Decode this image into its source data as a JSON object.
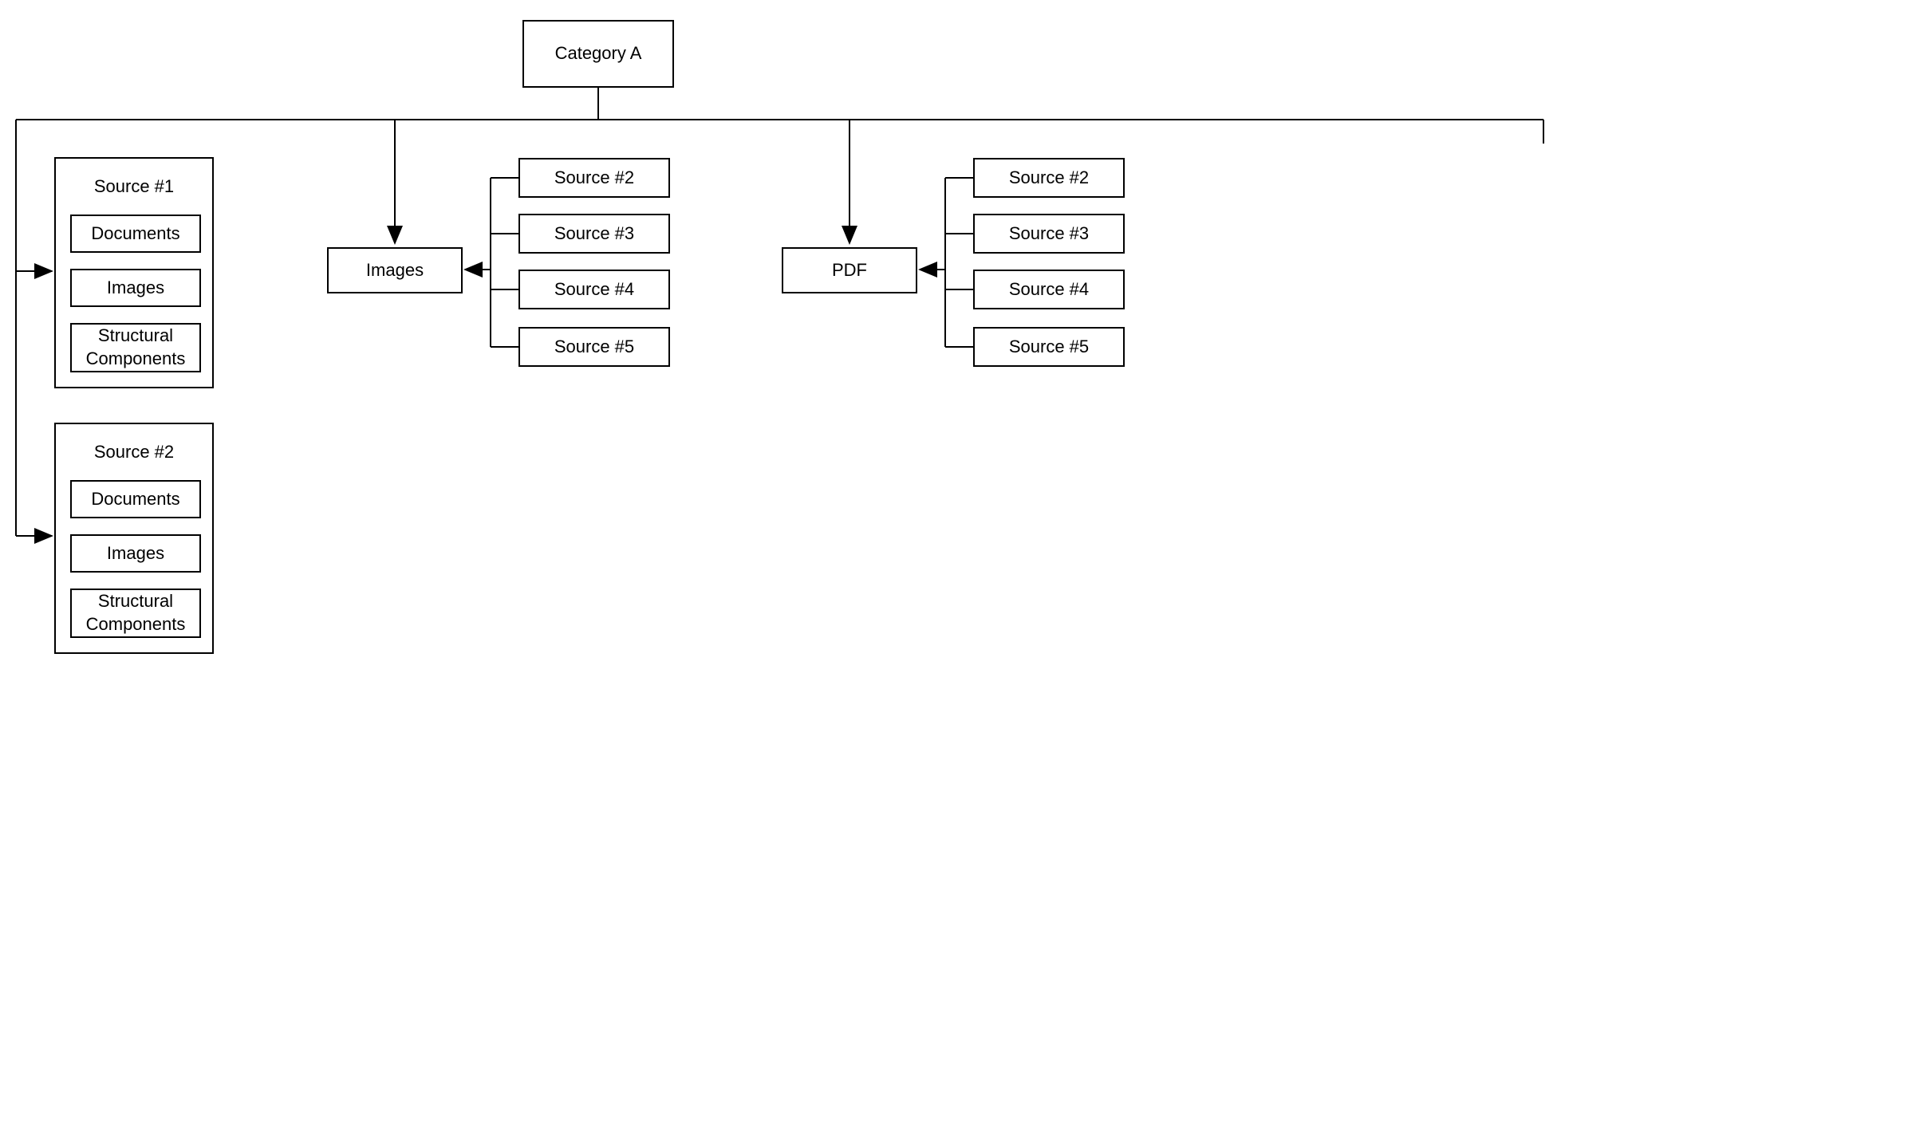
{
  "root": {
    "label": "Category A"
  },
  "left": {
    "source1": {
      "title": "Source #1",
      "items": [
        "Documents",
        "Images",
        "Structural Components"
      ]
    },
    "source2": {
      "title": "Source #2",
      "items": [
        "Documents",
        "Images",
        "Structural Components"
      ]
    }
  },
  "middle": {
    "label": "Images",
    "sources": [
      "Source #2",
      "Source #3",
      "Source #4",
      "Source #5"
    ]
  },
  "right": {
    "label": "PDF",
    "sources": [
      "Source #2",
      "Source #3",
      "Source #4",
      "Source #5"
    ]
  }
}
